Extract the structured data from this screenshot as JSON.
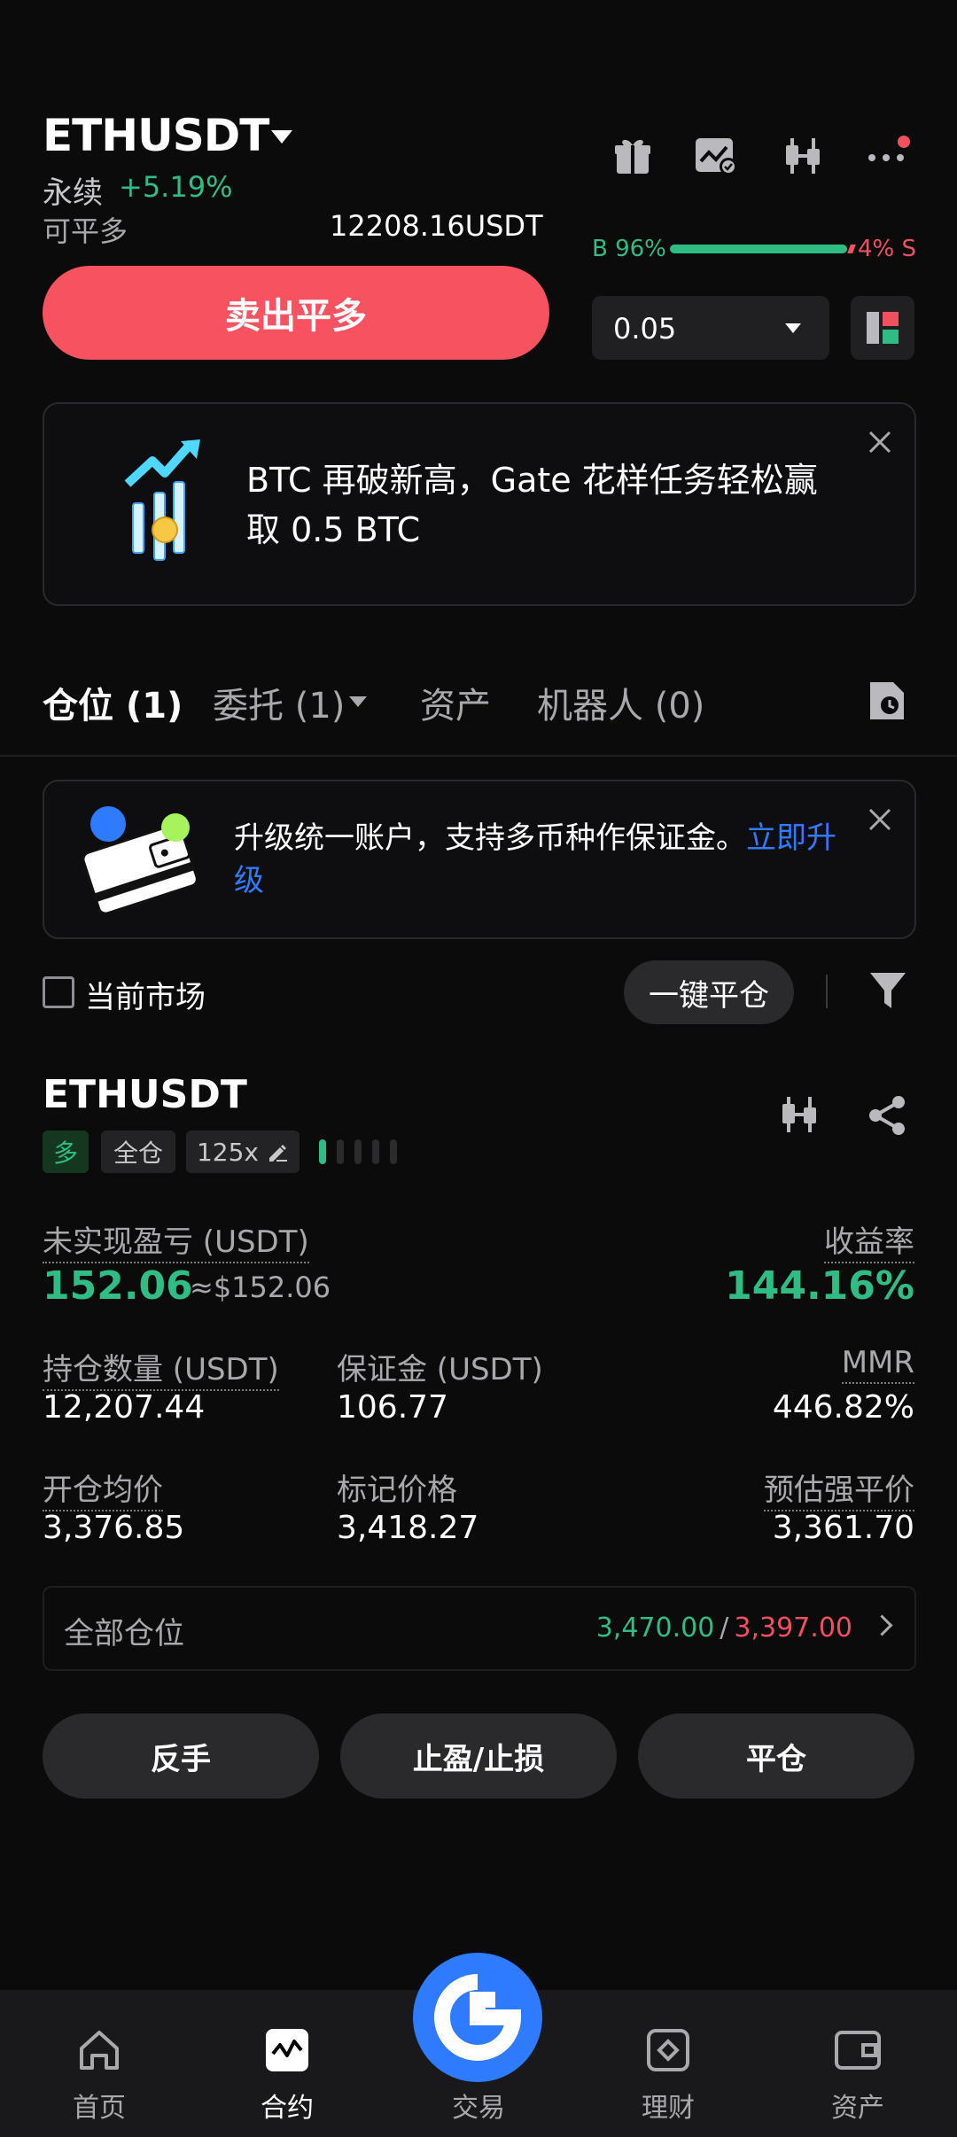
{
  "header": {
    "symbol": "ETHUSDT",
    "contract_type": "永续",
    "change": "+5.19%",
    "available_label": "可平多",
    "available_value": "12208.16USDT",
    "icons": [
      "gift-icon",
      "chart-settings-icon",
      "candlestick-icon",
      "more-icon"
    ]
  },
  "ratio": {
    "buy_label": "B 96%",
    "sell_label": "4% S",
    "buy_fraction": 0.96
  },
  "order": {
    "sell_button": "卖出平多",
    "quantity": "0.05"
  },
  "banner": {
    "text": "BTC 再破新高，Gate 花样任务轻松赢取 0.5 BTC"
  },
  "tabs": [
    {
      "label": "仓位 (1)",
      "active": true
    },
    {
      "label": "委托 (1)",
      "active": false
    },
    {
      "label": "资产",
      "active": false
    },
    {
      "label": "机器人 (0)",
      "active": false
    }
  ],
  "upgrade": {
    "text": "升级统一账户，支持多币种作保证金。",
    "link": "立即升级"
  },
  "filter": {
    "current_market": "当前市场",
    "close_all": "一键平仓"
  },
  "position": {
    "symbol": "ETHUSDT",
    "side": "多",
    "margin_mode": "全仓",
    "leverage": "125x",
    "risk_level": 1,
    "unrealized_pnl_label": "未实现盈亏 (USDT)",
    "unrealized_pnl": "152.06",
    "unrealized_pnl_usd": "≈$152.06",
    "roe_label": "收益率",
    "roe": "144.16%",
    "size_label": "持仓数量 (USDT)",
    "size": "12,207.44",
    "margin_label": "保证金 (USDT)",
    "margin": "106.77",
    "mmr_label": "MMR",
    "mmr": "446.82%",
    "entry_label": "开仓均价",
    "entry": "3,376.85",
    "mark_label": "标记价格",
    "mark": "3,418.27",
    "liq_label": "预估强平价",
    "liq": "3,361.70",
    "all_positions_label": "全部仓位",
    "tp_price": "3,470.00",
    "slash": "/",
    "sl_price": "3,397.00"
  },
  "actions": {
    "reverse": "反手",
    "tpsl": "止盈/止损",
    "close": "平仓"
  },
  "nav": [
    {
      "label": "首页",
      "icon": "home-icon"
    },
    {
      "label": "合约",
      "icon": "futures-icon"
    },
    {
      "label": "交易",
      "icon": "trade-logo-icon"
    },
    {
      "label": "理财",
      "icon": "earn-icon"
    },
    {
      "label": "资产",
      "icon": "wallet-icon"
    }
  ],
  "colors": {
    "green": "#2fbd85",
    "red": "#f0505f",
    "sell_button": "#f6525f",
    "accent_blue": "#2f7bff",
    "orange": "#f79a62"
  }
}
